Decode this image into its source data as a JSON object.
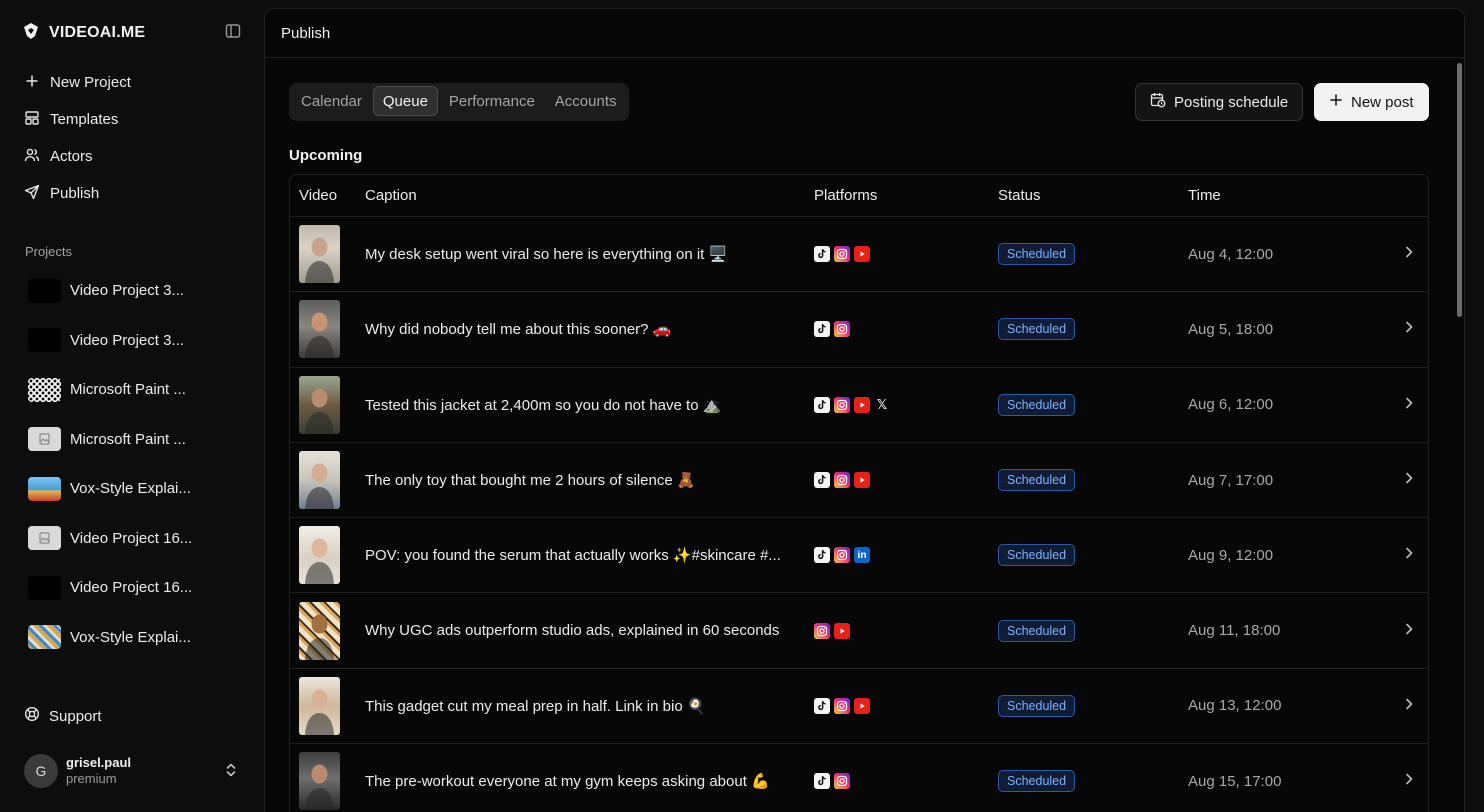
{
  "brand": {
    "name": "VIDEOAI.ME"
  },
  "nav": [
    {
      "label": "New Project",
      "icon": "plus-icon"
    },
    {
      "label": "Templates",
      "icon": "layout-icon"
    },
    {
      "label": "Actors",
      "icon": "users-icon"
    },
    {
      "label": "Publish",
      "icon": "send-icon"
    }
  ],
  "projects_label": "Projects",
  "projects": [
    {
      "name": "Video Project 3...",
      "thumb": "black"
    },
    {
      "name": "Video Project 3...",
      "thumb": "black"
    },
    {
      "name": "Microsoft Paint ...",
      "thumb": "pattern"
    },
    {
      "name": "Microsoft Paint ...",
      "thumb": "placeholder"
    },
    {
      "name": "Vox-Style Explai...",
      "thumb": "blue"
    },
    {
      "name": "Video Project 16...",
      "thumb": "placeholder"
    },
    {
      "name": "Video Project 16...",
      "thumb": "black"
    },
    {
      "name": "Vox-Style Explai...",
      "thumb": "collage"
    }
  ],
  "support": "Support",
  "user": {
    "initial": "G",
    "name": "grisel.paul",
    "plan": "premium"
  },
  "header": {
    "title": "Publish"
  },
  "tabs": [
    {
      "label": "Calendar",
      "active": false
    },
    {
      "label": "Queue",
      "active": true
    },
    {
      "label": "Performance",
      "active": false
    },
    {
      "label": "Accounts",
      "active": false
    }
  ],
  "actions": {
    "schedule_label": "Posting schedule",
    "new_post_label": "New post"
  },
  "section_title": "Upcoming",
  "table": {
    "headers": {
      "video": "Video",
      "caption": "Caption",
      "platforms": "Platforms",
      "status": "Status",
      "time": "Time"
    },
    "rows": [
      {
        "caption": "My desk setup went viral so here is everything on it 🖥️",
        "platforms": [
          "tiktok",
          "instagram",
          "youtube"
        ],
        "status": "Scheduled",
        "time": "Aug 4, 12:00"
      },
      {
        "caption": "Why did nobody tell me about this sooner? 🚗",
        "platforms": [
          "tiktok",
          "instagram"
        ],
        "status": "Scheduled",
        "time": "Aug 5, 18:00"
      },
      {
        "caption": "Tested this jacket at 2,400m so you do not have to ⛰️",
        "platforms": [
          "tiktok",
          "instagram",
          "youtube",
          "x"
        ],
        "status": "Scheduled",
        "time": "Aug 6, 12:00"
      },
      {
        "caption": "The only toy that bought me 2 hours of silence 🧸",
        "platforms": [
          "tiktok",
          "instagram",
          "youtube"
        ],
        "status": "Scheduled",
        "time": "Aug 7, 17:00"
      },
      {
        "caption": "POV: you found the serum that actually works ✨#skincare #...",
        "platforms": [
          "tiktok",
          "instagram",
          "linkedin"
        ],
        "status": "Scheduled",
        "time": "Aug 9, 12:00"
      },
      {
        "caption": "Why UGC ads outperform studio ads, explained in 60 seconds",
        "platforms": [
          "instagram",
          "youtube"
        ],
        "status": "Scheduled",
        "time": "Aug 11, 18:00"
      },
      {
        "caption": "This gadget cut my meal prep in half. Link in bio 🍳",
        "platforms": [
          "tiktok",
          "instagram",
          "youtube"
        ],
        "status": "Scheduled",
        "time": "Aug 13, 12:00"
      },
      {
        "caption": "The pre-workout everyone at my gym keeps asking about 💪",
        "platforms": [
          "tiktok",
          "instagram"
        ],
        "status": "Scheduled",
        "time": "Aug 15, 17:00"
      }
    ]
  },
  "colors": {
    "status_border": "#2b5aa8",
    "status_text": "#7fb0ff",
    "tiktok": "#f4f4f4",
    "youtube": "#e62117",
    "linkedin": "#0a66c2"
  }
}
